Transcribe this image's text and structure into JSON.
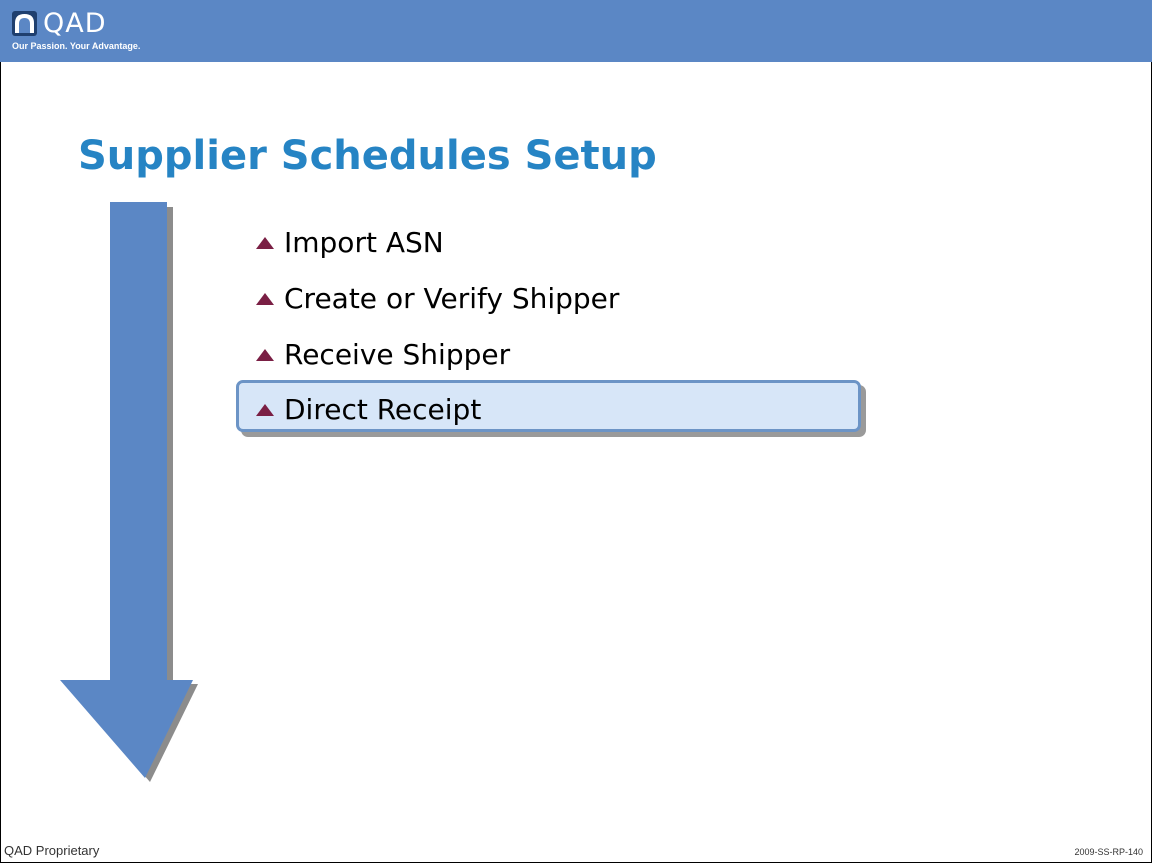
{
  "brand": {
    "name": "QAD",
    "tagline": "Our Passion. Your Advantage.",
    "header_color": "#5b87c5"
  },
  "slide": {
    "title": "Supplier Schedules Setup",
    "title_color": "#2684c4",
    "items": [
      {
        "label": "Import ASN",
        "highlighted": false
      },
      {
        "label": "Create or Verify Shipper",
        "highlighted": false
      },
      {
        "label": "Receive Shipper",
        "highlighted": false
      },
      {
        "label": "Direct Receipt",
        "highlighted": true
      }
    ],
    "bullet_color": "#7a1f44",
    "highlight_fill": "#d7e6f8",
    "highlight_border": "#6c94c6",
    "flow_arrow_icon": "down-arrow-icon"
  },
  "footer": {
    "left": "QAD Proprietary",
    "right": "2009-SS-RP-140"
  }
}
